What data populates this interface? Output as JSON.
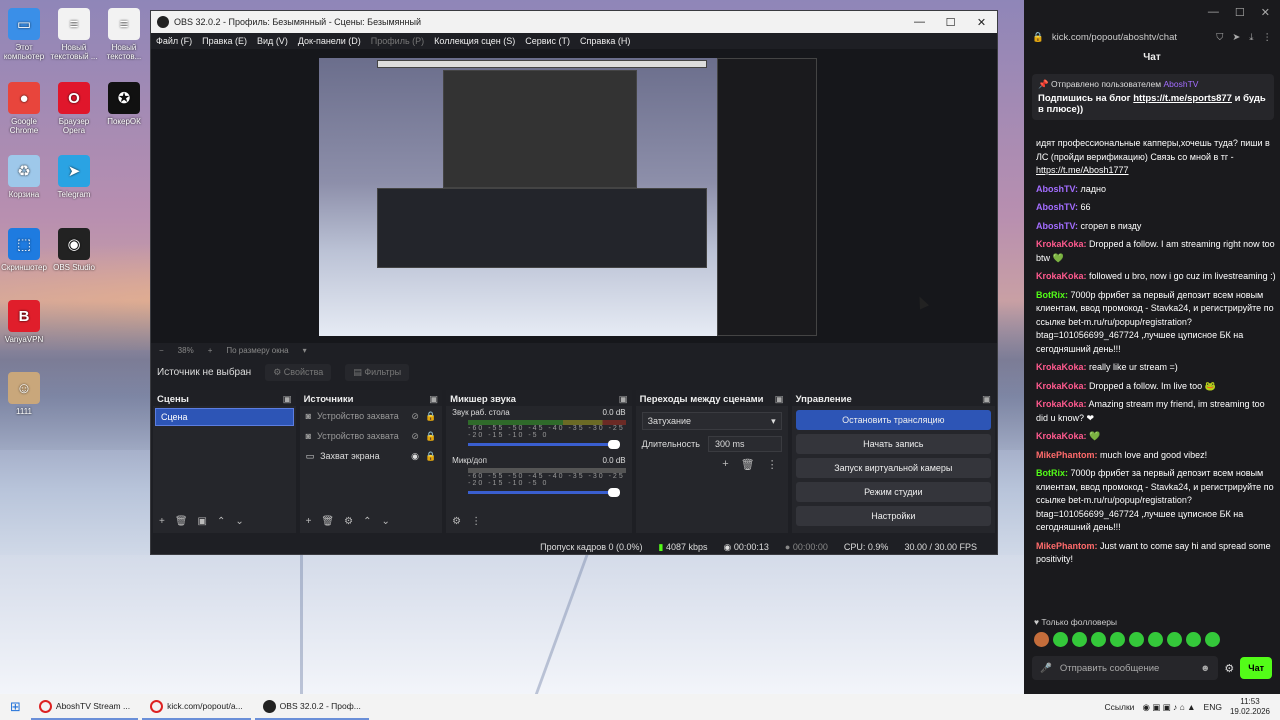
{
  "desktop": {
    "icons": [
      {
        "label": "Этот компьютер",
        "color": "#3a8fe8",
        "glyph": "▭"
      },
      {
        "label": "Новый текстовый ...",
        "color": "#f2f2f2",
        "glyph": "≡"
      },
      {
        "label": "Новый текстов...",
        "color": "#f2f2f2",
        "glyph": "≡"
      },
      {
        "label": "Google Chrome",
        "color": "#e8453c",
        "glyph": "●"
      },
      {
        "label": "Браузер Opera",
        "color": "#e0162b",
        "glyph": "O"
      },
      {
        "label": "ПокерОК",
        "color": "#111",
        "glyph": "✪"
      },
      {
        "label": "Корзина",
        "color": "#9ec8ea",
        "glyph": "♻"
      },
      {
        "label": "Telegram",
        "color": "#2aa3e3",
        "glyph": "➤"
      },
      {
        "label": "Скриншотер",
        "color": "#1e7be0",
        "glyph": "⬚"
      },
      {
        "label": "OBS Studio",
        "color": "#222",
        "glyph": "◉"
      },
      {
        "label": "VanyaVPN",
        "color": "#e01e2b",
        "glyph": "B"
      },
      {
        "label": "1111",
        "color": "#c9a77b",
        "glyph": "☺"
      }
    ]
  },
  "obs": {
    "title": "OBS 32.0.2 - Профиль: Безымянный - Сцены: Безымянный",
    "menu": [
      "Файл (F)",
      "Правка (E)",
      "Вид (V)",
      "Док-панели (D)",
      "Профиль (P)",
      "Коллекция сцен (S)",
      "Сервис (T)",
      "Справка (H)"
    ],
    "zoom": "38%",
    "fit": "По размеру окна",
    "no_source": "Источник не выбран",
    "props_btn": "Свойства",
    "filters_btn": "Фильтры",
    "scenes": {
      "title": "Сцены",
      "items": [
        "Сцена"
      ]
    },
    "sources": {
      "title": "Источники",
      "items": [
        "Устройство захвата",
        "Устройство захвата",
        "Захват экрана"
      ]
    },
    "mixer": {
      "title": "Микшер звука",
      "channels": [
        {
          "name": "Звук раб. стола",
          "db": "0.0 dB"
        },
        {
          "name": "Микр/доп",
          "db": "0.0 dB"
        }
      ],
      "scale": "-60 -55 -50 -45 -40 -35 -30 -25 -20 -15 -10 -5 0"
    },
    "transitions": {
      "title": "Переходы между сценами",
      "type": "Затухание",
      "duration_label": "Длительность",
      "duration": "300 ms"
    },
    "controls": {
      "title": "Управление",
      "buttons": [
        "Остановить трансляцию",
        "Начать запись",
        "Запуск виртуальной камеры",
        "Режим студии",
        "Настройки"
      ]
    },
    "status": {
      "dropped": "Пропуск кадров 0 (0.0%)",
      "kbps": "4087 kbps",
      "stream_time": "00:00:13",
      "rec_time": "00:00:00",
      "cpu": "CPU: 0.9%",
      "fps": "30.00 / 30.00 FPS"
    }
  },
  "chat": {
    "url": "kick.com/popout/aboshtv/chat",
    "title": "Чат",
    "pinned": {
      "header": "Отправлено пользователем",
      "by": "AboshTV",
      "text": "Подпишись на блог ",
      "link": "https://t.me/sports877",
      "tail": " и будь в плюсе))"
    },
    "messages": [
      {
        "user": "",
        "text": "идят профессиональные капперы,хочешь туда? пиши в ЛС (пройди верификацию) Связь со мной в тг - ",
        "link": "https://t.me/Abosh1777",
        "cls": ""
      },
      {
        "user": "AboshTV:",
        "text": " ладно",
        "cls": "purple"
      },
      {
        "user": "AboshTV:",
        "text": " 66",
        "cls": "purple"
      },
      {
        "user": "AboshTV:",
        "text": " сгорел в пизду",
        "cls": "purple"
      },
      {
        "user": "KrokaKoka:",
        "text": " Dropped a follow. I am streaming right now too btw 💚",
        "cls": "pink"
      },
      {
        "user": "KrokaKoka:",
        "text": " followed u bro, now i go cuz im livestreaming :)",
        "cls": "pink"
      },
      {
        "user": "BotRix:",
        "text": " 7000р фрибет за первый депозит всем новым клиентам, ввод промокод - Stavka24, и регистрируйте по ссылке bet-m.ru/ru/popup/registration?btag=101056699_467724 ,лучшее цуписное БК на сегодняшний день!!!",
        "cls": "green"
      },
      {
        "user": "KrokaKoka:",
        "text": " really like ur stream =)",
        "cls": "pink"
      },
      {
        "user": "KrokaKoka:",
        "text": " Dropped a follow. Im live too 🐸",
        "cls": "pink"
      },
      {
        "user": "KrokaKoka:",
        "text": " Amazing stream my friend, im streaming too did u know? ❤",
        "cls": "pink"
      },
      {
        "user": "KrokaKoka:",
        "text": " 💚",
        "cls": "pink"
      },
      {
        "user": "MikePhantom:",
        "text": " much love and good vibez!",
        "cls": "red"
      },
      {
        "user": "BotRix:",
        "text": " 7000р фрибет за первый депозит всем новым клиентам, ввод промокод - Stavka24, и регистрируйте по ссылке bet-m.ru/ru/popup/registration?btag=101056699_467724 ,лучшее цуписное БК на сегодняшний день!!!",
        "cls": "green"
      },
      {
        "user": "MikePhantom:",
        "text": " Just want to come say hi and spread some positivity!",
        "cls": "red"
      }
    ],
    "followers": "Только фолловеры",
    "placeholder": "Отправить сообщение",
    "send": "Чат"
  },
  "taskbar": {
    "items": [
      "AboshTV Stream ...",
      "kick.com/popout/a...",
      "OBS 32.0.2 - Проф..."
    ],
    "links": "Ссылки",
    "lang": "ENG",
    "time": "11:53",
    "date": "19.02.2026"
  }
}
